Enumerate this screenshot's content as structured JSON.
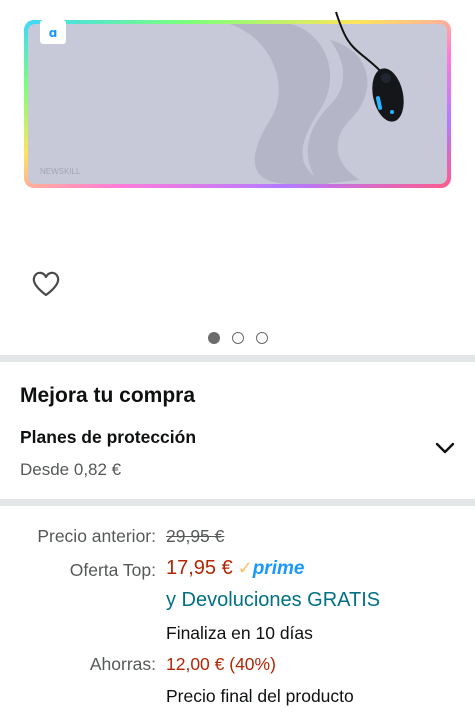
{
  "product": {
    "image_alt": "Alfombrilla gaming RGB gris con ratón",
    "brand_watermark": "NEWSKILL",
    "wishlist_icon": "heart-outline-icon",
    "carousel": {
      "count": 3,
      "active": 0
    }
  },
  "upgrade": {
    "title": "Mejora tu compra",
    "plan_title": "Planes de protección",
    "plan_from": "Desde 0,82 €",
    "expand_icon": "chevron-down-icon"
  },
  "pricing": {
    "previous_label": "Precio anterior:",
    "previous_value": "29,95 €",
    "offer_label": "Oferta Top:",
    "offer_value": "17,95 €",
    "prime_check": "✓",
    "prime_label": "prime",
    "returns": "y Devoluciones GRATIS",
    "ends": "Finaliza en 10 días",
    "savings_label": "Ahorras:",
    "savings_value": "12,00 € (40%)",
    "final_note": "Precio final del producto"
  },
  "colors": {
    "price_red": "#B12704",
    "link_teal": "#007185",
    "prime_blue": "#1A98FF",
    "divider": "#E3E6E6"
  }
}
